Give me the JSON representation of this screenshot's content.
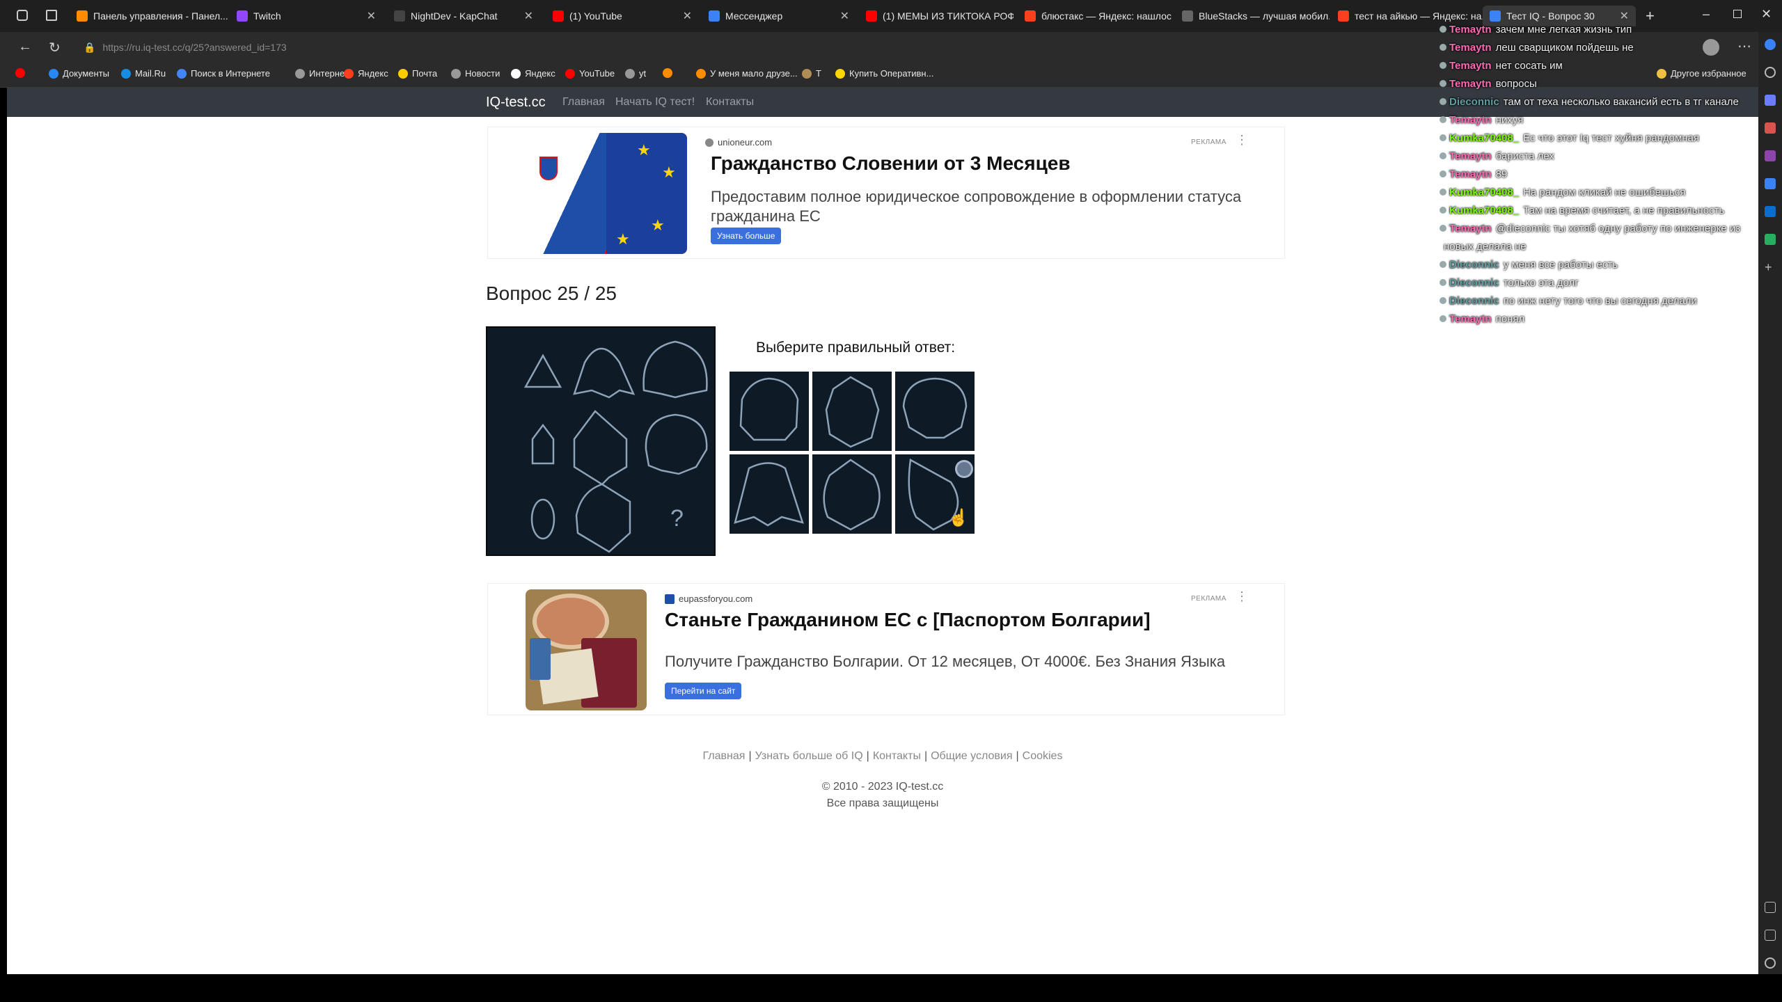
{
  "tabs": [
    {
      "title": "Панель управления - Панел...",
      "color": "#ff8c00"
    },
    {
      "title": "Twitch",
      "color": "#9146ff"
    },
    {
      "title": "NightDev - KapChat",
      "color": "#444"
    },
    {
      "title": "(1) YouTube",
      "color": "#ff0000"
    },
    {
      "title": "Мессенджер",
      "color": "#3b82f6"
    },
    {
      "title": "(1) МЕМЫ ИЗ ТИКТОКА РОФ...",
      "color": "#ff0000"
    },
    {
      "title": "блюстакс — Яндекс: нашлос...",
      "color": "#fc3f1d"
    },
    {
      "title": "BlueStacks — лучшая мобил...",
      "color": "#666"
    },
    {
      "title": "тест на айкью — Яндекс: на...",
      "color": "#fc3f1d"
    },
    {
      "title": "Тест IQ - Вопрос 30",
      "color": "#3b82f6"
    }
  ],
  "address": {
    "url": "https://ru.iq-test.cc/q/25?answered_id=173"
  },
  "bookmarks": [
    {
      "label": "",
      "color": "#ff0000"
    },
    {
      "label": "Документы",
      "color": "#2787f5"
    },
    {
      "label": "Mail.Ru",
      "color": "#168de2"
    },
    {
      "label": "Поиск в Интернете",
      "color": "#4285f4"
    },
    {
      "label": "Интернет",
      "color": "#999"
    },
    {
      "label": "Яндекс",
      "color": "#fc3f1d"
    },
    {
      "label": "Почта",
      "color": "#ffcc00"
    },
    {
      "label": "Новости",
      "color": "#999"
    },
    {
      "label": "Яндекс",
      "color": "#fff"
    },
    {
      "label": "YouTube",
      "color": "#ff0000"
    },
    {
      "label": "yt",
      "color": "#999"
    },
    {
      "label": "",
      "color": "#ff8c00"
    },
    {
      "label": "У меня мало друзе...",
      "color": "#ff8c00"
    },
    {
      "label": "T",
      "color": "#b08d57"
    },
    {
      "label": "Купить Оперативн...",
      "color": "#ffd700"
    },
    {
      "label": "Другое избранное",
      "color": "#f0c040"
    }
  ],
  "site": {
    "brand": "IQ-test.cc",
    "nav": [
      "Главная",
      "Начать IQ тест!",
      "Контакты"
    ]
  },
  "ad1": {
    "domain": "unioneur.com",
    "tag": "РЕКЛАМА",
    "title": "Гражданство Словении от 3 Месяцев",
    "text": "Предоставим полное юридическое сопровождение в оформлении статуса гражданина ЕС",
    "button": "Узнать больше"
  },
  "question": {
    "title": "Вопрос 25 / 25",
    "prompt": "Выберите правильный ответ:",
    "mark": "?"
  },
  "ad2": {
    "domain": "eupassforyou.com",
    "tag": "РЕКЛАМА",
    "title": "Станьте Гражданином ЕС с [Паспортом Болгарии]",
    "text": "Получите Гражданство Болгарии. От 12 месяцев, От 4000€. Без Знания Языка",
    "button": "Перейти на сайт"
  },
  "footer": {
    "links": [
      "Главная",
      "Узнать больше об IQ",
      "Контакты",
      "Общие условия",
      "Cookies"
    ],
    "sep": "|",
    "copyright": "© 2010 - 2023 IQ-test.cc",
    "rights": "Все права защищены"
  },
  "chat": [
    {
      "user": "Temaytn",
      "msg": "зачем мне легкая жизнь тип",
      "color": "#ff69b4"
    },
    {
      "user": "Temaytn",
      "msg": "леш сварщиком пойдешь не",
      "color": "#ff69b4"
    },
    {
      "user": "Temaytn",
      "msg": "нет сосать им",
      "color": "#ff69b4"
    },
    {
      "user": "Temaytn",
      "msg": "вопросы",
      "color": "#ff69b4"
    },
    {
      "user": "Dieconnic",
      "msg": "там от теха несколько вакансий есть в тг канале",
      "color": "#5f9ea0"
    },
    {
      "user": "Temaytn",
      "msg": "нихуя",
      "color": "#ff69b4"
    },
    {
      "user": "Kumka70408_",
      "msg": "Ес что этот Iq тест хуйня рандомная",
      "color": "#7cfc00"
    },
    {
      "user": "Temaytn",
      "msg": "бариста лех",
      "color": "#ff69b4"
    },
    {
      "user": "Temaytn",
      "msg": "89",
      "color": "#ff69b4"
    },
    {
      "user": "Kumka70408_",
      "msg": "На рандом кликай не ошибешься",
      "color": "#7cfc00"
    },
    {
      "user": "Kumka70408_",
      "msg": "Там на время считает, а не правильность",
      "color": "#7cfc00"
    },
    {
      "user": "Temaytn",
      "msg": "@dieconnic ты хотяб одну работу по инженерке из",
      "color": "#ff69b4"
    },
    {
      "user": "",
      "msg": "новых делала не",
      "color": "#ff69b4"
    },
    {
      "user": "Dieconnic",
      "msg": "у меня все работы есть",
      "color": "#5f9ea0"
    },
    {
      "user": "Dieconnic",
      "msg": "только эта долг",
      "color": "#5f9ea0"
    },
    {
      "user": "Dieconnic",
      "msg": "по инж нету того что вы сегодня делали",
      "color": "#5f9ea0"
    },
    {
      "user": "Temaytn",
      "msg": "понял",
      "color": "#ff69b4"
    }
  ]
}
